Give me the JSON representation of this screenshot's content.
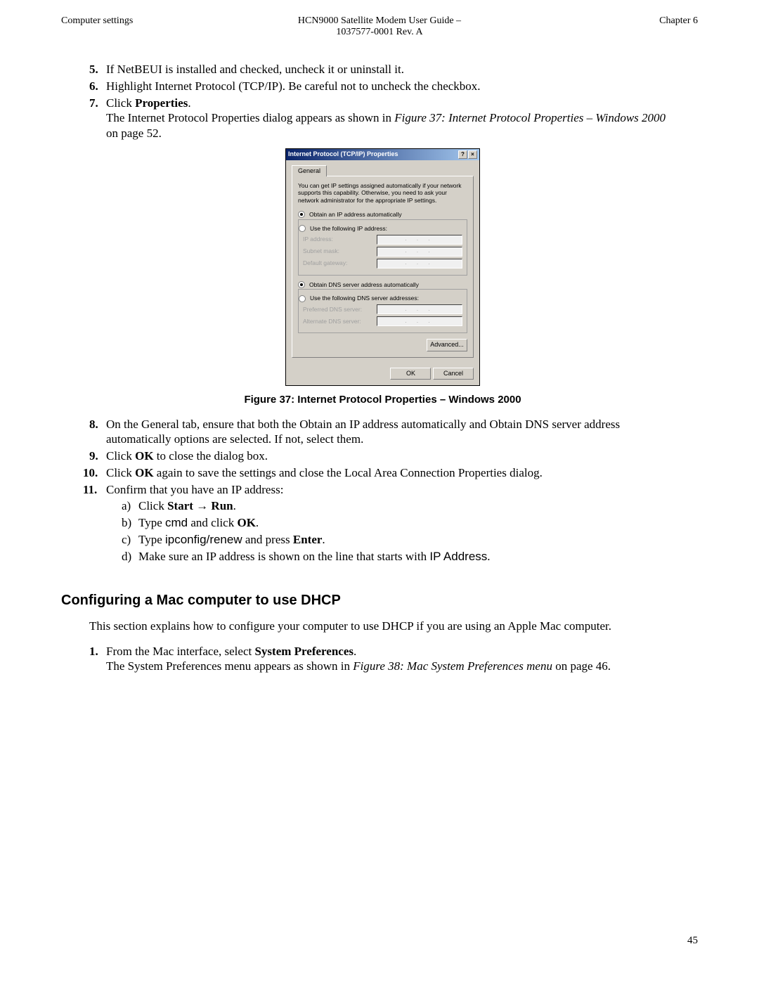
{
  "header": {
    "left": "Computer settings",
    "center_line1": "HCN9000 Satellite Modem User Guide –",
    "center_line2": "1037577-0001 Rev. A",
    "right": "Chapter 6"
  },
  "steps": {
    "s5": "If NetBEUI is installed and checked, uncheck it or uninstall it.",
    "s6": "Highlight Internet Protocol (TCP/IP). Be careful not to uncheck the checkbox.",
    "s7a": "Click ",
    "s7b": "Properties",
    "s7c": ".",
    "s7line2a": "The Internet Protocol Properties dialog appears as shown in ",
    "s7line2b": "Figure 37: Internet Protocol Properties – Windows 2000",
    "s7line2c": " on page 52.",
    "s8": "On the General tab, ensure that both the Obtain an IP address automatically and Obtain DNS server address automatically options are selected. If not, select them.",
    "s9a": "Click ",
    "s9b": "OK",
    "s9c": " to close the dialog box.",
    "s10a": "Click ",
    "s10b": "OK",
    "s10c": " again to save the settings and close the Local Area Connection Properties dialog.",
    "s11": "Confirm that you have an IP address:",
    "s11a1": "Click ",
    "s11a2": "Start",
    "s11a3": " → ",
    "s11a4": "Run",
    "s11a5": ".",
    "s11b1": "Type ",
    "s11b2": "cmd",
    "s11b3": " and click ",
    "s11b4": "OK",
    "s11b5": ".",
    "s11c1": "Type ",
    "s11c2": "ipconfig/renew",
    "s11c3": " and press ",
    "s11c4": "Enter",
    "s11c5": ".",
    "s11d1": "Make sure an IP address is shown on the line that starts with ",
    "s11d2": "IP Address",
    "s11d3": "."
  },
  "figure_caption": "Figure 37: Internet Protocol Properties – Windows 2000",
  "dialog": {
    "title": "Internet Protocol (TCP/IP) Properties",
    "help_btn": "?",
    "close_btn": "×",
    "tab": "General",
    "desc": "You can get IP settings assigned automatically if your network supports this capability. Otherwise, you need to ask your network administrator for the appropriate IP settings.",
    "radio_ip_auto": "Obtain an IP address automatically",
    "radio_ip_manual": "Use the following IP address:",
    "ip_address": "IP address:",
    "subnet": "Subnet mask:",
    "gateway": "Default gateway:",
    "radio_dns_auto": "Obtain DNS server address automatically",
    "radio_dns_manual": "Use the following DNS server addresses:",
    "pref_dns": "Preferred DNS server:",
    "alt_dns": "Alternate DNS server:",
    "advanced": "Advanced...",
    "ok": "OK",
    "cancel": "Cancel",
    "dots": ". . ."
  },
  "section2": {
    "title": "Configuring a Mac computer to use DHCP",
    "intro": "This section explains how to configure your computer to use DHCP if you are using an Apple Mac computer.",
    "s1a": "From the Mac interface, select ",
    "s1b": "System Preferences",
    "s1c": ".",
    "s1line2a": "The System Preferences menu appears as shown in ",
    "s1line2b": "Figure 38: Mac System Preferences menu",
    "s1line2c": " on page 46."
  },
  "page_num": "45"
}
